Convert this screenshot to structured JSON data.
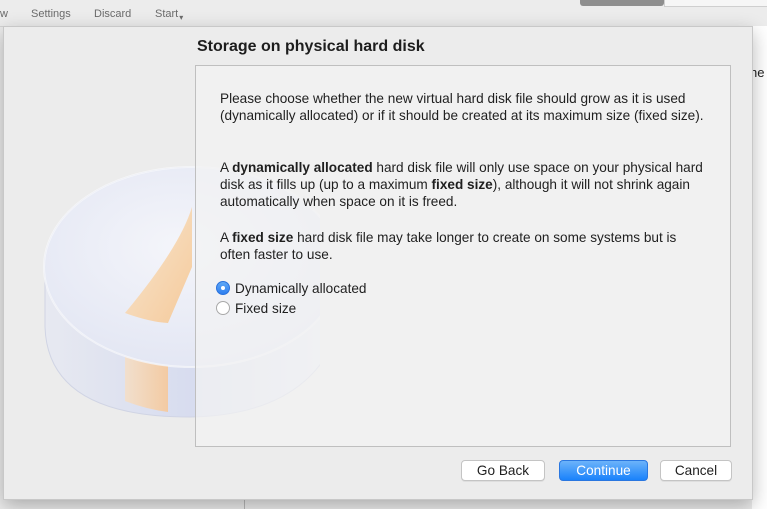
{
  "background_toolbar": {
    "items": [
      "w",
      "Settings",
      "Discard",
      "Start"
    ]
  },
  "background_right_fragment": "he",
  "dialog": {
    "title": "Storage on physical hard disk",
    "paragraph1": "Please choose whether the new virtual hard disk file should grow as it is used (dynamically allocated) or if it should be created at its maximum size (fixed size).",
    "paragraph2": {
      "t1": "A ",
      "b1": "dynamically allocated",
      "t2": " hard disk file will only use space on your physical hard disk as it fills up (up to a maximum ",
      "b2": "fixed size",
      "t3": "), although it will not shrink again automatically when space on it is freed."
    },
    "paragraph3": {
      "t1": "A ",
      "b1": "fixed size",
      "t2": " hard disk file may take longer to create on some systems but is often faster to use."
    },
    "options": [
      {
        "label": "Dynamically allocated",
        "selected": true
      },
      {
        "label": "Fixed size",
        "selected": false
      }
    ],
    "buttons": {
      "back": "Go Back",
      "continue": "Continue",
      "cancel": "Cancel"
    }
  },
  "icons": [
    "disk-illustration-icon",
    "dropdown-caret-icon",
    "radio-selected-icon",
    "radio-unselected-icon"
  ],
  "colors": {
    "accent": "#1a82fb",
    "sheet_bg": "#ececec",
    "content_bg": "#f2f2f2"
  }
}
